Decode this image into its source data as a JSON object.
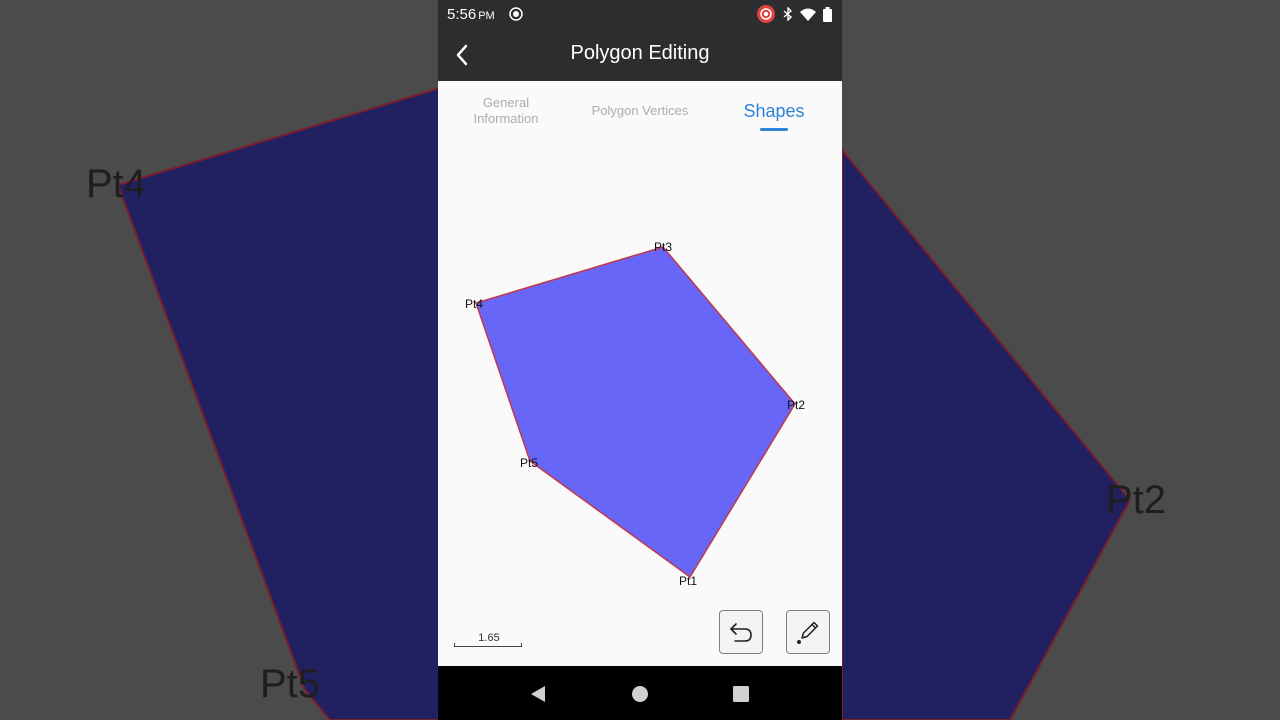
{
  "status_bar": {
    "time": "5:56",
    "ampm": "PM"
  },
  "app_bar": {
    "title": "Polygon Editing"
  },
  "tabs": [
    {
      "label_line1": "General",
      "label_line2": "Information"
    },
    {
      "label": "Polygon Vertices"
    },
    {
      "label": "Shapes"
    }
  ],
  "polygon": {
    "vertices": [
      "Pt1",
      "Pt2",
      "Pt3",
      "Pt4",
      "Pt5"
    ],
    "fill_color": "#6766f7",
    "stroke_color": "#c0394a"
  },
  "scale": {
    "value": "1.65"
  },
  "colors": {
    "accent": "#2d83d6",
    "app_bar": "#2b2d2e"
  }
}
